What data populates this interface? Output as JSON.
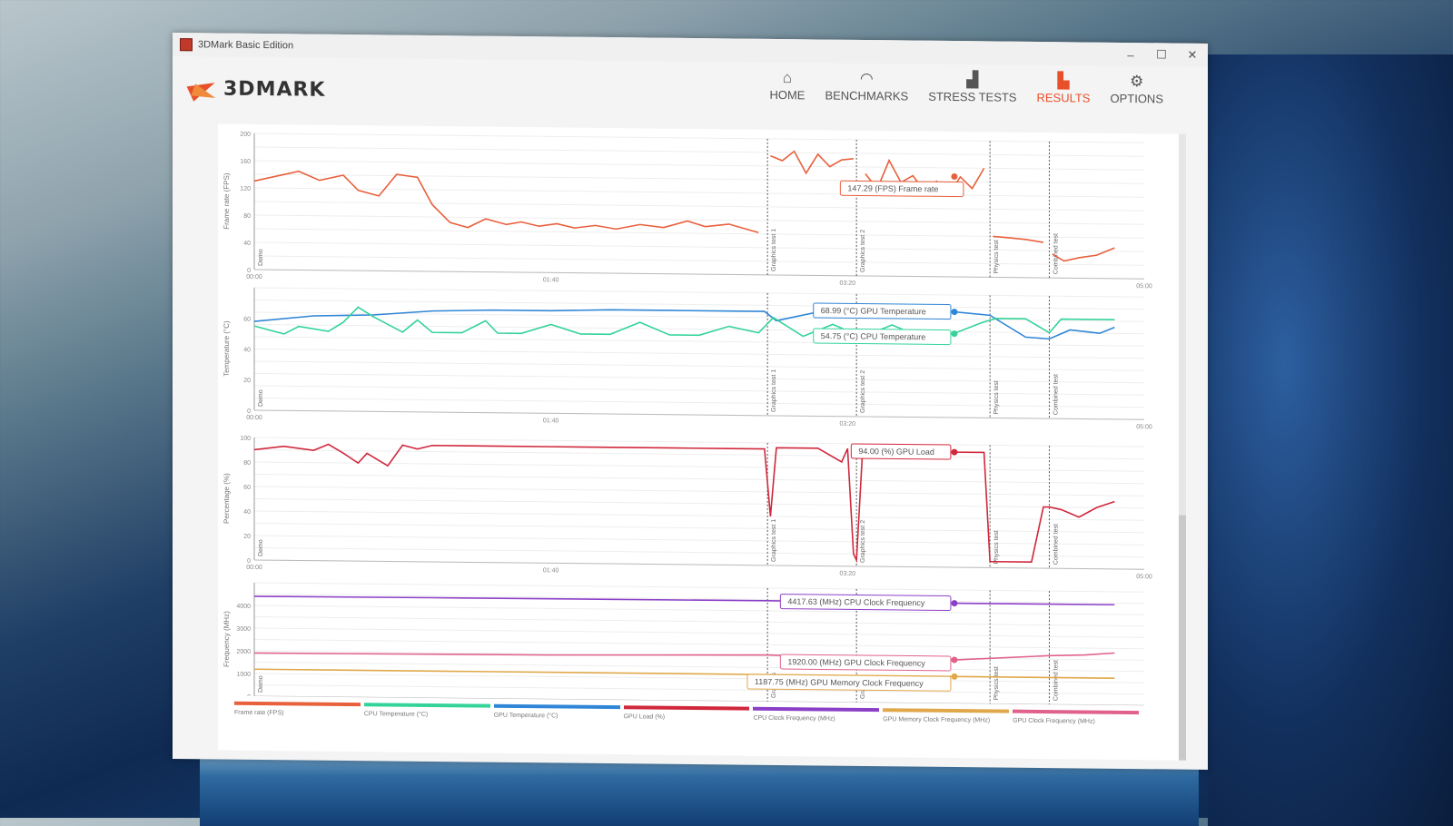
{
  "window": {
    "title": "3DMark Basic Edition",
    "controls": [
      "–",
      "☐",
      "✕"
    ]
  },
  "logo": {
    "text": "3DMARK"
  },
  "nav": [
    {
      "label": "HOME",
      "icon": "home-icon",
      "glyph": "⌂"
    },
    {
      "label": "BENCHMARKS",
      "icon": "gauge-icon",
      "glyph": "◠"
    },
    {
      "label": "STRESS TESTS",
      "icon": "bar-chart-icon",
      "glyph": "▟"
    },
    {
      "label": "RESULTS",
      "icon": "results-chart-icon",
      "glyph": "▙",
      "active": true
    },
    {
      "label": "OPTIONS",
      "icon": "gear-icon",
      "glyph": "⚙"
    }
  ],
  "colors": {
    "accent": "#e8502a",
    "frame_rate": "#e8603c",
    "cpu_temp": "#34d399",
    "gpu_temp": "#2f86d6",
    "gpu_load": "#d0283c",
    "cpu_clock": "#8b3fc7",
    "gpu_mem_clock": "#e0a84a",
    "gpu_clock": "#e0628a"
  },
  "chart_data": [
    {
      "type": "line",
      "ylabel": "Frame rate (FPS)",
      "yticks": [
        "0",
        "40",
        "80",
        "120",
        "160",
        "200"
      ],
      "ylim": [
        0,
        200
      ],
      "xticks": [
        "00:00",
        "01:40",
        "03:20",
        "05:00"
      ],
      "xlim": [
        0,
        300
      ],
      "markers": [
        {
          "t": 0,
          "label": "Demo"
        },
        {
          "t": 173,
          "label": "Graphics test 1"
        },
        {
          "t": 203,
          "label": "Graphics test 2"
        },
        {
          "t": 248,
          "label": "Physics test"
        },
        {
          "t": 268,
          "label": "Combined test"
        }
      ],
      "series": [
        {
          "name": "Frame rate (FPS)",
          "color": "#e8603c",
          "segments": [
            {
              "x": [
                0,
                8,
                15,
                22,
                30,
                35,
                42,
                48,
                55,
                60,
                66,
                72,
                78,
                85,
                90,
                96,
                102,
                108,
                115,
                122,
                130,
                138,
                146,
                152,
                160,
                165,
                170
              ],
              "y": [
                130,
                138,
                145,
                132,
                140,
                118,
                110,
                142,
                138,
                98,
                72,
                65,
                78,
                70,
                74,
                68,
                72,
                66,
                70,
                65,
                72,
                68,
                78,
                70,
                74,
                68,
                62
              ]
            },
            {
              "x": [
                174,
                178,
                182,
                186,
                190,
                194,
                198,
                202
              ],
              "y": [
                175,
                168,
                182,
                150,
                178,
                160,
                170,
                172
              ]
            },
            {
              "x": [
                206,
                210,
                214,
                218,
                222,
                226,
                230,
                234,
                238,
                242,
                246
              ],
              "y": [
                150,
                128,
                170,
                138,
                148,
                125,
                140,
                120,
                147,
                130,
                160
              ]
            },
            {
              "x": [
                249,
                255,
                260,
                266
              ],
              "y": [
                60,
                58,
                56,
                52
              ]
            },
            {
              "x": [
                269,
                273,
                278,
                284,
                290
              ],
              "y": [
                35,
                25,
                30,
                34,
                45
              ]
            }
          ]
        }
      ],
      "tooltips": [
        {
          "text": "147.29 (FPS) Frame rate",
          "x": 236,
          "y": 147.29,
          "color": "#e8603c"
        }
      ]
    },
    {
      "type": "line",
      "ylabel": "Temperature (°C)",
      "yticks": [
        "0",
        "20",
        "40",
        "60"
      ],
      "ylim": [
        0,
        80
      ],
      "xticks": [
        "00:00",
        "01:40",
        "03:20",
        "05:00"
      ],
      "xlim": [
        0,
        300
      ],
      "markers": [
        {
          "t": 0,
          "label": "Demo"
        },
        {
          "t": 173,
          "label": "Graphics test 1"
        },
        {
          "t": 203,
          "label": "Graphics test 2"
        },
        {
          "t": 248,
          "label": "Physics test"
        },
        {
          "t": 268,
          "label": "Combined test"
        }
      ],
      "series": [
        {
          "name": "GPU Temperature (°C)",
          "color": "#2f86d6",
          "x": [
            0,
            20,
            40,
            60,
            80,
            100,
            120,
            140,
            160,
            172,
            176,
            190,
            210,
            236,
            248,
            260,
            268,
            275,
            285,
            290
          ],
          "y": [
            58,
            62,
            63,
            66,
            67,
            67,
            68,
            68,
            68,
            68,
            62,
            68,
            69,
            69,
            67,
            53,
            52,
            58,
            56,
            60
          ]
        },
        {
          "name": "CPU Temperature (°C)",
          "color": "#34d399",
          "x": [
            0,
            10,
            15,
            25,
            30,
            35,
            40,
            50,
            55,
            60,
            70,
            78,
            82,
            90,
            100,
            110,
            120,
            130,
            140,
            150,
            160,
            170,
            175,
            185,
            195,
            205,
            215,
            225,
            236,
            245,
            250,
            260,
            268,
            272,
            280,
            290
          ],
          "y": [
            55,
            50,
            55,
            52,
            58,
            68,
            62,
            52,
            60,
            52,
            52,
            60,
            52,
            52,
            58,
            52,
            52,
            60,
            52,
            52,
            58,
            54,
            64,
            52,
            60,
            52,
            60,
            52,
            55,
            62,
            65,
            65,
            56,
            65,
            65,
            65
          ]
        }
      ],
      "tooltips": [
        {
          "text": "68.99 (°C) GPU Temperature",
          "x": 236,
          "y": 68.99,
          "color": "#2f86d6"
        },
        {
          "text": "54.75 (°C) CPU Temperature",
          "x": 236,
          "y": 54.75,
          "color": "#34d399"
        }
      ]
    },
    {
      "type": "line",
      "ylabel": "Percentage (%)",
      "yticks": [
        "0",
        "20",
        "40",
        "60",
        "80",
        "100"
      ],
      "ylim": [
        0,
        100
      ],
      "xticks": [
        "00:00",
        "01:40",
        "03:20",
        "05:00"
      ],
      "xlim": [
        0,
        300
      ],
      "markers": [
        {
          "t": 0,
          "label": "Demo"
        },
        {
          "t": 173,
          "label": "Graphics test 1"
        },
        {
          "t": 203,
          "label": "Graphics test 2"
        },
        {
          "t": 248,
          "label": "Physics test"
        },
        {
          "t": 268,
          "label": "Combined test"
        }
      ],
      "series": [
        {
          "name": "GPU Load (%)",
          "color": "#d0283c",
          "x": [
            0,
            10,
            20,
            25,
            30,
            35,
            38,
            45,
            50,
            55,
            60,
            80,
            100,
            120,
            140,
            160,
            172,
            174,
            176,
            190,
            198,
            200,
            202,
            203,
            205,
            215,
            236,
            246,
            248,
            250,
            262,
            266,
            268,
            272,
            278,
            284,
            290
          ],
          "y": [
            90,
            93,
            90,
            95,
            88,
            80,
            88,
            78,
            95,
            92,
            95,
            95,
            95,
            95,
            95,
            95,
            95,
            40,
            96,
            96,
            85,
            96,
            10,
            5,
            92,
            94,
            94,
            94,
            5,
            5,
            5,
            50,
            50,
            48,
            42,
            50,
            55
          ]
        }
      ],
      "tooltips": [
        {
          "text": "94.00 (%) GPU Load",
          "x": 236,
          "y": 94.0,
          "color": "#d0283c"
        }
      ]
    },
    {
      "type": "line",
      "ylabel": "Frequency (MHz)",
      "yticks": [
        "0",
        "1000",
        "2000",
        "3000",
        "4000"
      ],
      "ylim": [
        0,
        5000
      ],
      "xticks": [
        "00:00",
        "01:40",
        "03:20",
        "05:00"
      ],
      "xlim": [
        0,
        300
      ],
      "markers": [
        {
          "t": 0,
          "label": "Demo"
        },
        {
          "t": 173,
          "label": "Graphics"
        },
        {
          "t": 203,
          "label": "Graphic"
        },
        {
          "t": 248,
          "label": "Physics test"
        },
        {
          "t": 268,
          "label": "Combined test"
        }
      ],
      "series": [
        {
          "name": "CPU Clock Frequency (MHz)",
          "color": "#8b3fc7",
          "x": [
            0,
            60,
            120,
            173,
            200,
            236,
            260,
            290
          ],
          "y": [
            4400,
            4420,
            4430,
            4440,
            4430,
            4417.63,
            4420,
            4425
          ]
        },
        {
          "name": "GPU Clock Frequency (MHz)",
          "color": "#e0628a",
          "x": [
            0,
            100,
            173,
            236,
            268,
            280,
            290
          ],
          "y": [
            1900,
            1950,
            2050,
            1920,
            2150,
            2200,
            2300
          ]
        },
        {
          "name": "GPU Memory Clock Frequency (MHz)",
          "color": "#e0a84a",
          "x": [
            0,
            290
          ],
          "y": [
            1187.75,
            1187.75
          ]
        }
      ],
      "tooltips": [
        {
          "text": "4417.63 (MHz) CPU Clock Frequency",
          "x": 236,
          "y": 4417.63,
          "color": "#8b3fc7"
        },
        {
          "text": "1920.00 (MHz) GPU Clock Frequency",
          "x": 236,
          "y": 1920.0,
          "color": "#e0628a"
        },
        {
          "text": "1187.75 (MHz) GPU Memory Clock Frequency",
          "x": 236,
          "y": 1187.75,
          "color": "#e0a84a"
        }
      ]
    }
  ],
  "legend": [
    {
      "label": "Frame rate (FPS)",
      "color": "#e8603c"
    },
    {
      "label": "CPU Temperature (°C)",
      "color": "#34d399"
    },
    {
      "label": "GPU Temperature (°C)",
      "color": "#2f86d6"
    },
    {
      "label": "GPU Load (%)",
      "color": "#d0283c"
    },
    {
      "label": "CPU Clock Frequency (MHz)",
      "color": "#8b3fc7"
    },
    {
      "label": "GPU Memory Clock Frequency (MHz)",
      "color": "#e0a84a"
    },
    {
      "label": "GPU Clock Frequency (MHz)",
      "color": "#e0628a"
    }
  ]
}
